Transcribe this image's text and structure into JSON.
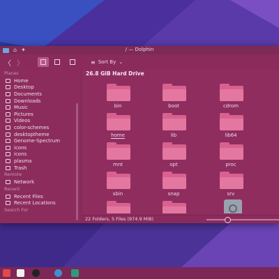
{
  "window": {
    "title": "/ — Dolphin"
  },
  "toolbar": {
    "back_glyph": "〈",
    "forward_glyph": "〉",
    "sort_label": "Sort By",
    "sort_chevron": "⌄",
    "sort_icon": "≡"
  },
  "sidebar": {
    "sections": {
      "places": "Places",
      "remote": "Remote",
      "recent": "Recent",
      "search": "Search For"
    },
    "places": [
      {
        "label": "Home",
        "icon": "home-icon"
      },
      {
        "label": "Desktop",
        "icon": "desktop-icon"
      },
      {
        "label": "Documents",
        "icon": "documents-icon"
      },
      {
        "label": "Downloads",
        "icon": "downloads-icon"
      },
      {
        "label": "Music",
        "icon": "music-icon"
      },
      {
        "label": "Pictures",
        "icon": "pictures-icon"
      },
      {
        "label": "Videos",
        "icon": "videos-icon"
      },
      {
        "label": "color-schemes",
        "icon": "folder-icon"
      },
      {
        "label": "desktoptheme",
        "icon": "folder-icon"
      },
      {
        "label": "Genome-Spectrum",
        "icon": "folder-icon"
      },
      {
        "label": "icons",
        "icon": "folder-icon"
      },
      {
        "label": "icons",
        "icon": "folder-icon"
      },
      {
        "label": "plasma",
        "icon": "folder-icon"
      },
      {
        "label": "Trash",
        "icon": "trash-icon"
      }
    ],
    "remote": [
      {
        "label": "Network",
        "icon": "network-icon"
      }
    ],
    "recent": [
      {
        "label": "Recent Files",
        "icon": "recent-files-icon"
      },
      {
        "label": "Recent Locations",
        "icon": "recent-locations-icon"
      }
    ]
  },
  "content": {
    "location": "26.8 GiB Hard Drive",
    "items": [
      {
        "name": "bin",
        "kind": "folder"
      },
      {
        "name": "boot",
        "kind": "folder"
      },
      {
        "name": "cdrom",
        "kind": "folder"
      },
      {
        "name": "home",
        "kind": "folder",
        "selected": true
      },
      {
        "name": "lib",
        "kind": "folder"
      },
      {
        "name": "lib64",
        "kind": "folder"
      },
      {
        "name": "mnt",
        "kind": "folder"
      },
      {
        "name": "opt",
        "kind": "folder"
      },
      {
        "name": "proc",
        "kind": "folder"
      },
      {
        "name": "sbin",
        "kind": "folder"
      },
      {
        "name": "snap",
        "kind": "folder"
      },
      {
        "name": "srv",
        "kind": "folder"
      },
      {
        "name": "",
        "kind": "folder"
      },
      {
        "name": "",
        "kind": "folder"
      },
      {
        "name": "",
        "kind": "file"
      }
    ]
  },
  "status": {
    "summary": "22 Folders, 5 Files (974.9 MiB)"
  },
  "colors": {
    "window_bg": "#8e2c5e",
    "folder": "#e4779f",
    "wallpaper": "#2c3fa0",
    "panel": "#7c2757"
  }
}
